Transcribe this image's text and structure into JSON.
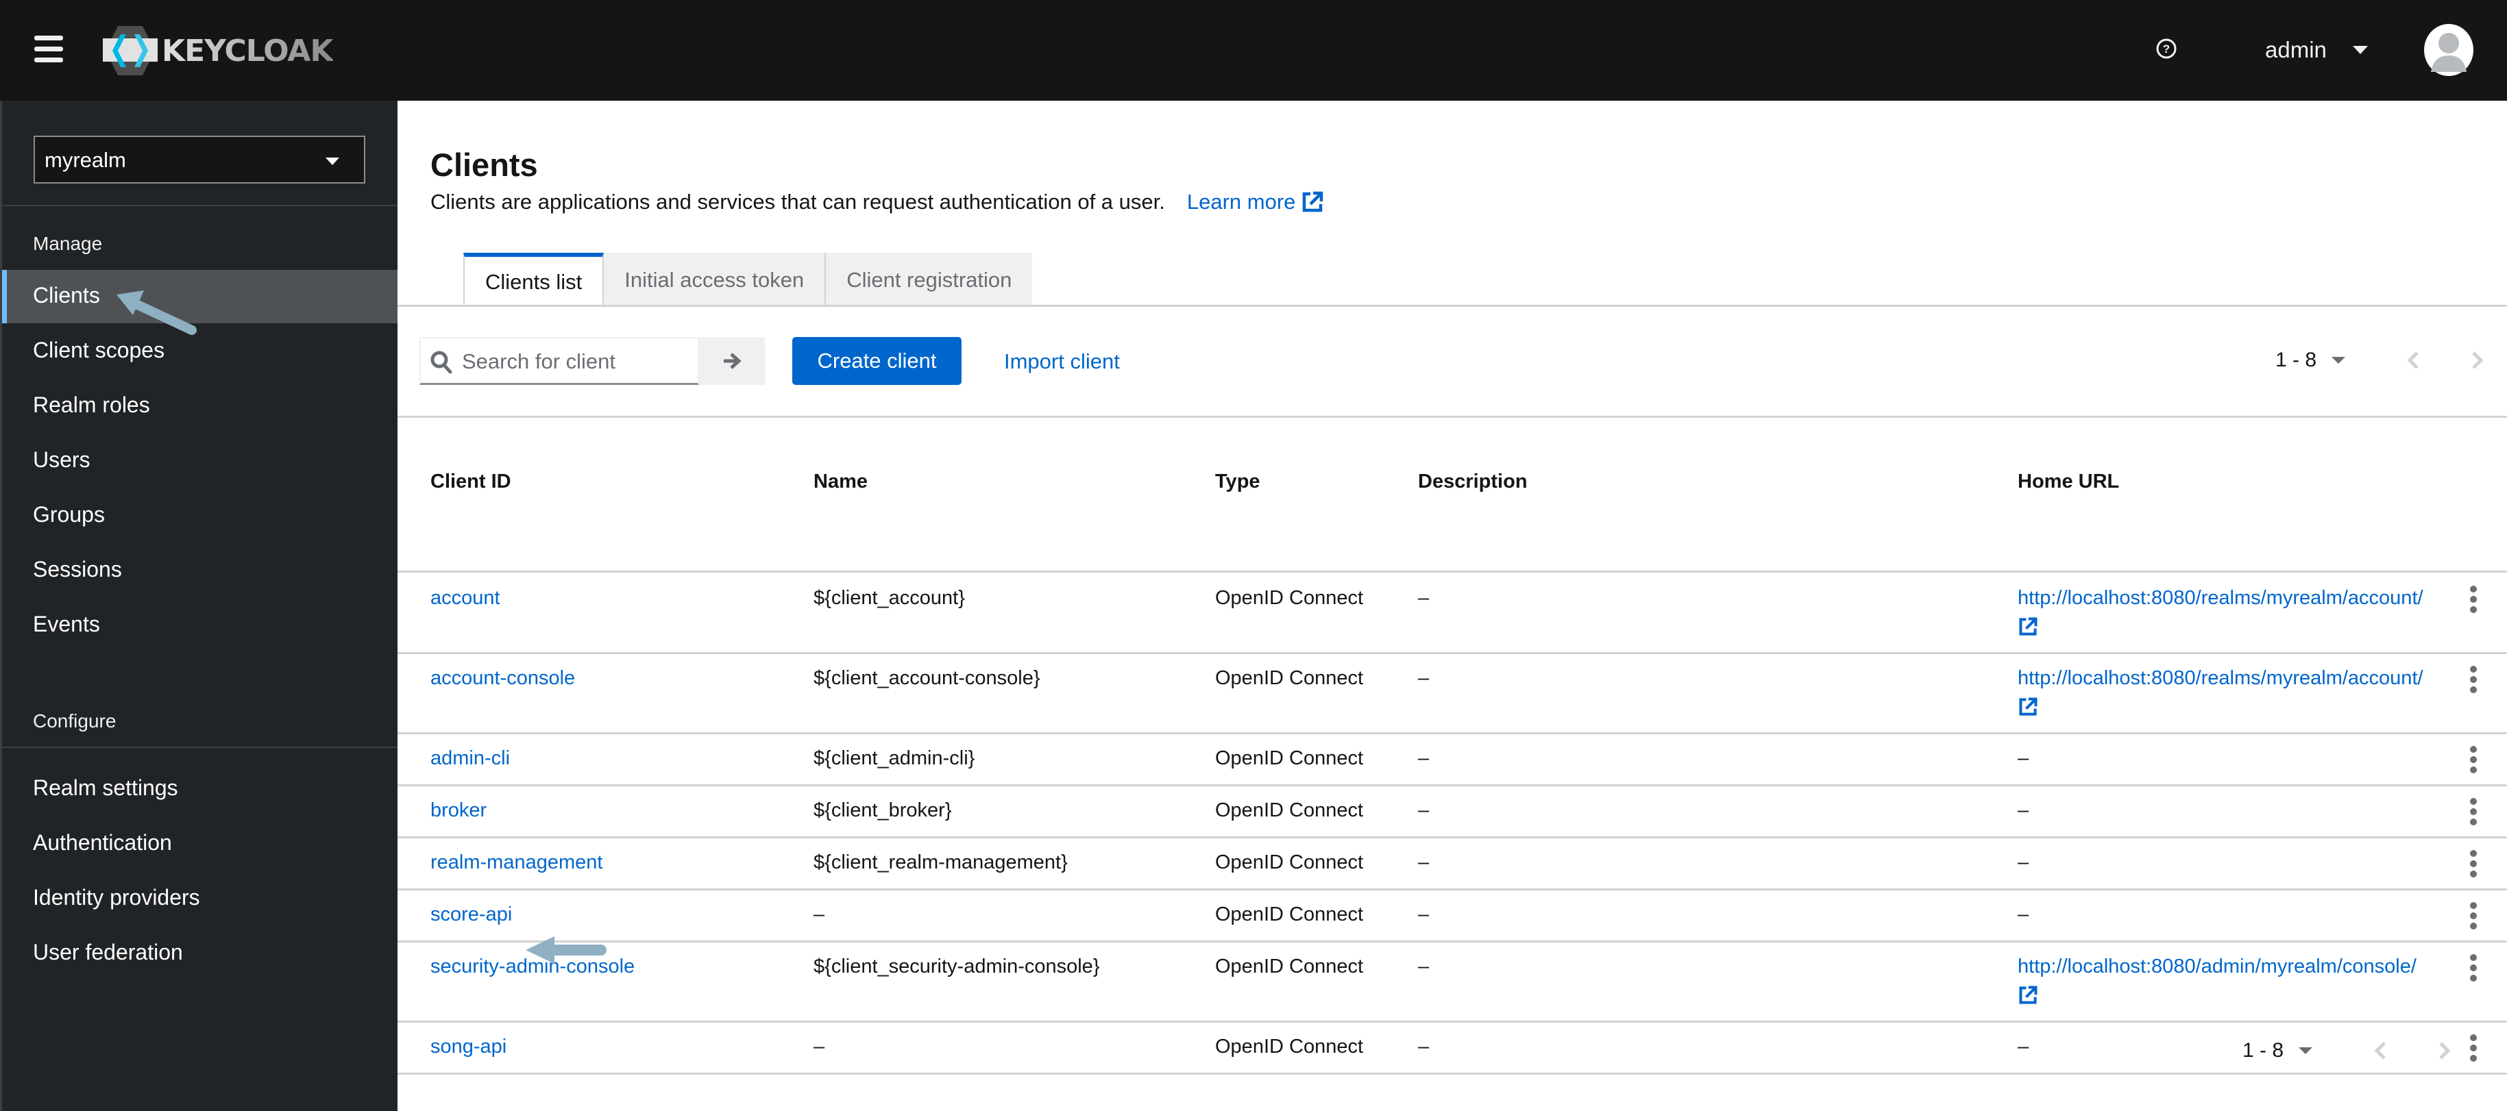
{
  "header": {
    "brand": "KEYCLOAK",
    "username": "admin",
    "icons": [
      "hamburger-menu-icon",
      "keycloak-logo-icon",
      "help-icon",
      "caret-down-icon",
      "avatar-icon"
    ]
  },
  "sidebar": {
    "realm": "myrealm",
    "sections": [
      {
        "label": "Manage",
        "items": [
          "Clients",
          "Client scopes",
          "Realm roles",
          "Users",
          "Groups",
          "Sessions",
          "Events"
        ]
      },
      {
        "label": "Configure",
        "items": [
          "Realm settings",
          "Authentication",
          "Identity providers",
          "User federation"
        ]
      }
    ],
    "active_item": "Clients"
  },
  "page": {
    "title": "Clients",
    "description": "Clients are applications and services that can request authentication of a user.",
    "learn_more": "Learn more",
    "tabs": [
      {
        "label": "Clients list",
        "active": true
      },
      {
        "label": "Initial access token",
        "active": false
      },
      {
        "label": "Client registration",
        "active": false
      }
    ]
  },
  "toolbar": {
    "search_placeholder": "Search for client",
    "create_label": "Create client",
    "import_label": "Import client",
    "pagination": "1 - 8"
  },
  "table": {
    "columns": [
      "Client ID",
      "Name",
      "Type",
      "Description",
      "Home URL"
    ],
    "rows": [
      {
        "client_id": "account",
        "name": "${client_account}",
        "type": "OpenID Connect",
        "description": "–",
        "home_url": "http://localhost:8080/realms/myrealm/account/",
        "external": true
      },
      {
        "client_id": "account-console",
        "name": "${client_account-console}",
        "type": "OpenID Connect",
        "description": "–",
        "home_url": "http://localhost:8080/realms/myrealm/account/",
        "external": true
      },
      {
        "client_id": "admin-cli",
        "name": "${client_admin-cli}",
        "type": "OpenID Connect",
        "description": "–",
        "home_url": "–",
        "external": false
      },
      {
        "client_id": "broker",
        "name": "${client_broker}",
        "type": "OpenID Connect",
        "description": "–",
        "home_url": "–",
        "external": false
      },
      {
        "client_id": "realm-management",
        "name": "${client_realm-management}",
        "type": "OpenID Connect",
        "description": "–",
        "home_url": "–",
        "external": false
      },
      {
        "client_id": "score-api",
        "name": "–",
        "type": "OpenID Connect",
        "description": "–",
        "home_url": "–",
        "external": false
      },
      {
        "client_id": "security-admin-console",
        "name": "${client_security-admin-console}",
        "type": "OpenID Connect",
        "description": "–",
        "home_url": "http://localhost:8080/admin/myrealm/console/",
        "external": true
      },
      {
        "client_id": "song-api",
        "name": "–",
        "type": "OpenID Connect",
        "description": "–",
        "home_url": "–",
        "external": false
      }
    ]
  },
  "footer": {
    "pagination": "1 - 8"
  },
  "colors": {
    "accent": "#0066cc",
    "masthead": "#151515",
    "sidebar": "#212427",
    "sidebar_active": "#4f5255",
    "active_indicator": "#73bcf7",
    "annotation_arrow": "#8fb0c3"
  }
}
